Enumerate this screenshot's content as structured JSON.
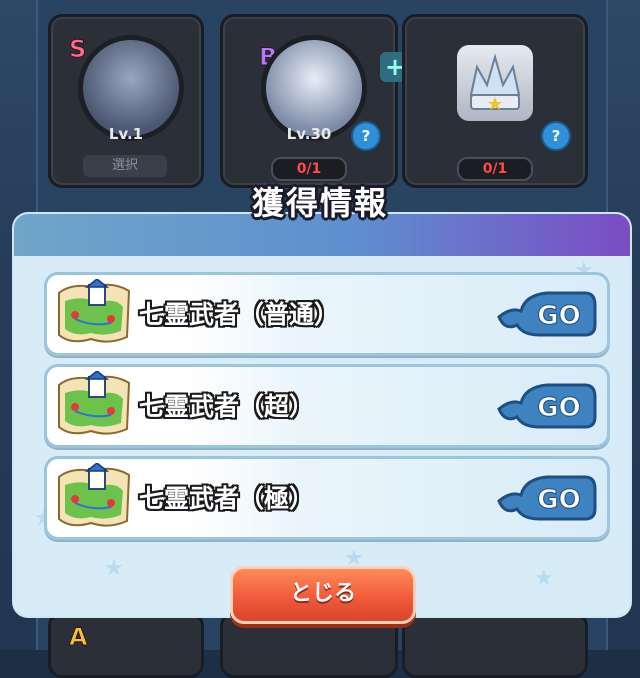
{
  "background": {
    "cards": [
      {
        "rank": "S",
        "level": "Lv.1",
        "select_label": "選択"
      },
      {
        "rank": "B",
        "level": "Lv.30",
        "count": "0/1",
        "help": "?"
      },
      {
        "rank": "",
        "count": "0/1",
        "help": "?"
      }
    ],
    "plus_symbol": "+",
    "bottom_rank": "A"
  },
  "modal": {
    "title": "獲得情報",
    "rows": [
      {
        "label": "七霊武者（普通）",
        "go_label": "GO",
        "icon": "map-icon"
      },
      {
        "label": "七霊武者（超）",
        "go_label": "GO",
        "icon": "map-icon"
      },
      {
        "label": "七霊武者（極）",
        "go_label": "GO",
        "icon": "map-icon"
      }
    ],
    "close_label": "とじる"
  },
  "colors": {
    "header_left": "#6fa6c9",
    "header_right": "#7b4cc4",
    "panel_bg": "#d7ecf6",
    "go_button": "#3f82c0",
    "close_button": "#f15a3a",
    "count_red": "#ff4a4a"
  }
}
